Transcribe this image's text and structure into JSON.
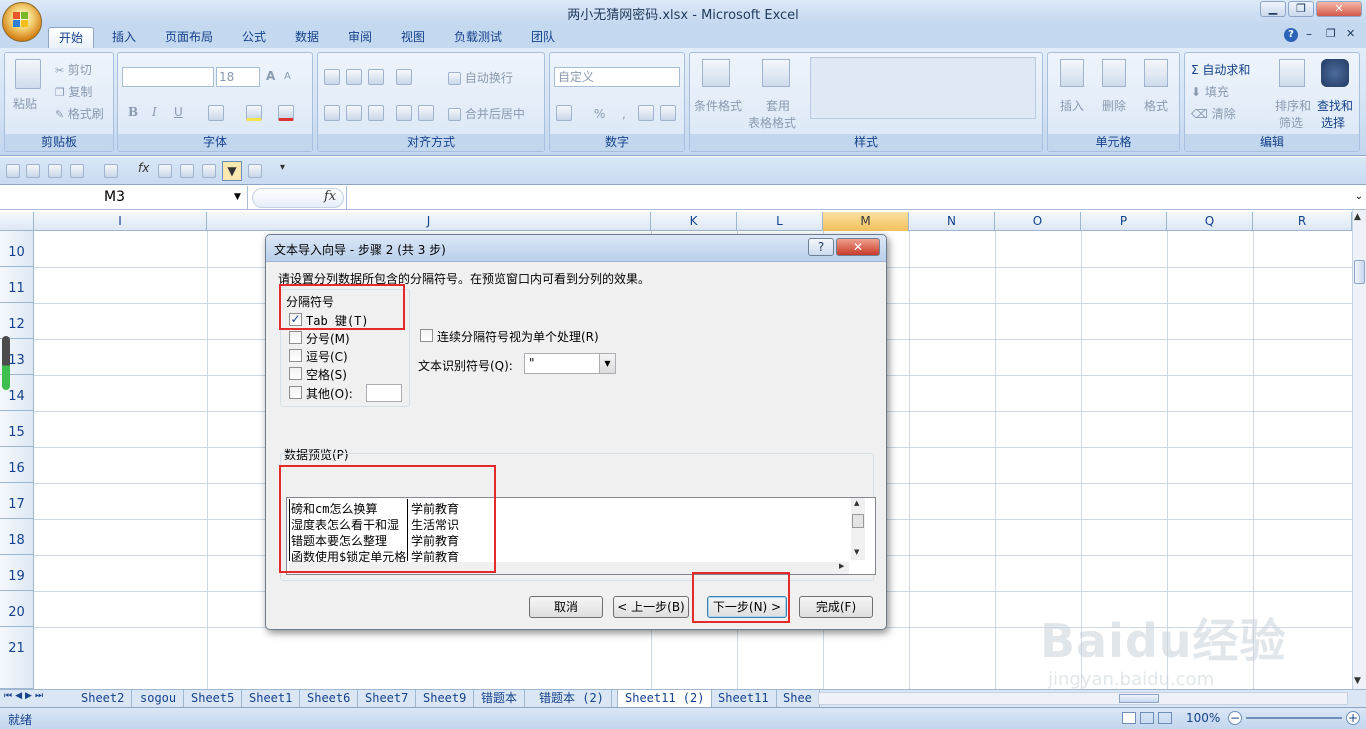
{
  "window": {
    "title": "两小无猜网密码.xlsx - Microsoft Excel",
    "min": "▁",
    "max": "❐",
    "close": "✕"
  },
  "tabs": [
    "开始",
    "插入",
    "页面布局",
    "公式",
    "数据",
    "审阅",
    "视图",
    "负载测试",
    "团队"
  ],
  "tab_help": {
    "help": "?",
    "min": "–",
    "restore": "❐",
    "close": "✕"
  },
  "ribbon": {
    "clipboard": {
      "label": "剪贴板",
      "paste": "粘贴",
      "cut": "剪切",
      "copy": "复制",
      "format_painter": "格式刷"
    },
    "font": {
      "label": "字体",
      "size": "18",
      "bold": "B",
      "italic": "I",
      "underline": "U",
      "grow": "A",
      "shrink": "A"
    },
    "alignment": {
      "label": "对齐方式",
      "wrap": "自动换行",
      "merge": "合并后居中"
    },
    "number": {
      "label": "数字",
      "format": "自定义",
      "percent": "%",
      "comma": ","
    },
    "styles": {
      "label": "样式",
      "conditional": "条件格式",
      "table1": "套用",
      "table2": "表格格式"
    },
    "cells": {
      "label": "单元格",
      "insert": "插入",
      "delete": "删除",
      "format": "格式"
    },
    "editing": {
      "label": "编辑",
      "autosum": "自动求和",
      "fill": "填充",
      "clear": "清除",
      "sort1": "排序和",
      "sort2": "筛选",
      "find1": "查找和",
      "find2": "选择"
    }
  },
  "formula_bar": {
    "name_box": "M3",
    "fx": "fx"
  },
  "columns": [
    "I",
    "J",
    "K",
    "L",
    "M",
    "N",
    "O",
    "P",
    "Q",
    "R"
  ],
  "selected_column": "M",
  "rows": [
    "10",
    "11",
    "12",
    "13",
    "14",
    "15",
    "16",
    "17",
    "18",
    "19",
    "20",
    "21"
  ],
  "sheets": [
    "Sheet2",
    "sogou",
    "Sheet5",
    "Sheet1",
    "Sheet6",
    "Sheet7",
    "Sheet9",
    "错题本",
    "错题本 (2)",
    "Sheet11 (2)",
    "Sheet11",
    "Shee"
  ],
  "active_sheet": "Sheet11 (2)",
  "status": {
    "ready": "就绪",
    "zoom": "100%"
  },
  "dialog": {
    "title": "文本导入向导 - 步骤 2 (共 3 步)",
    "help": "?",
    "close": "✕",
    "instruction": "请设置分列数据所包含的分隔符号。在预览窗口内可看到分列的效果。",
    "delimiters_label": "分隔符号",
    "tab": "Tab 键(T)",
    "semicolon": "分号(M)",
    "comma": "逗号(C)",
    "space": "空格(S)",
    "other": "其他(O):",
    "consecutive": "连续分隔符号视为单个处理(R)",
    "qualifier_label": "文本识别符号(Q):",
    "qualifier_value": "\"",
    "preview_label": "数据预览(P)",
    "preview_rows": [
      [
        "磅和cm怎么换算",
        "学前教育"
      ],
      [
        "湿度表怎么看干和湿",
        "生活常识"
      ],
      [
        "错题本要怎么整理",
        "学前教育"
      ],
      [
        "函数使用$锁定单元格",
        "学前教育"
      ]
    ],
    "buttons": {
      "cancel": "取消",
      "back": "< 上一步(B)",
      "next": "下一步(N) >",
      "finish": "完成(F)"
    }
  },
  "watermark": {
    "brand": "Baidu经验",
    "url": "jingyan.baidu.com"
  }
}
